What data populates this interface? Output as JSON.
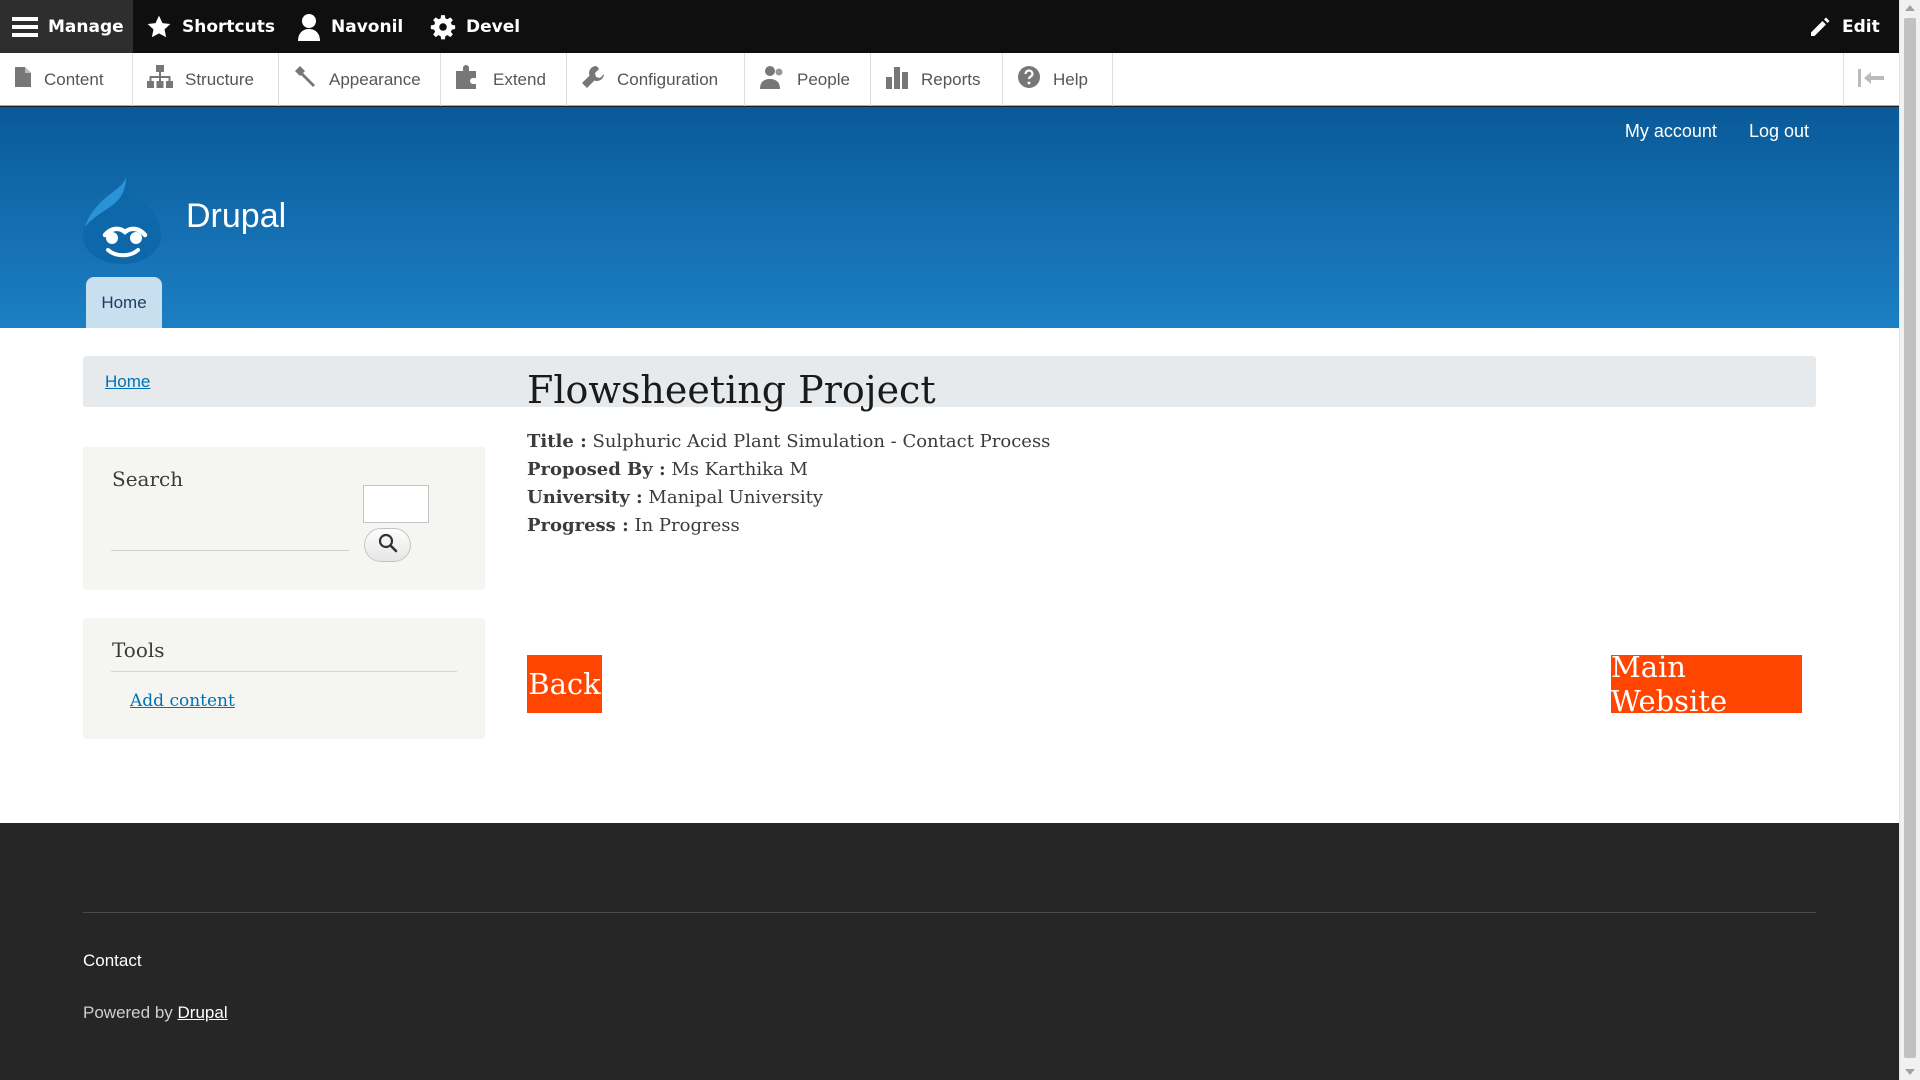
{
  "toolbar": {
    "manage": "Manage",
    "shortcuts": "Shortcuts",
    "user": "Navonil",
    "devel": "Devel",
    "edit": "Edit"
  },
  "tray": {
    "items": [
      "Content",
      "Structure",
      "Appearance",
      "Extend",
      "Configuration",
      "People",
      "Reports",
      "Help"
    ]
  },
  "header": {
    "my_account": "My account",
    "log_out": "Log out",
    "site_name": "Drupal",
    "home_tab": "Home"
  },
  "breadcrumb": {
    "home": "Home"
  },
  "sidebar": {
    "search_title": "Search",
    "tools_title": "Tools",
    "add_content": "Add content"
  },
  "content": {
    "title": "Flowsheeting Project",
    "fields": [
      {
        "label": "Title :",
        "value": "Sulphuric Acid Plant Simulation - Contact Process"
      },
      {
        "label": "Proposed By :",
        "value": "Ms Karthika M"
      },
      {
        "label": "University :",
        "value": "Manipal University"
      },
      {
        "label": "Progress :",
        "value": "In Progress"
      }
    ],
    "back_button": "Back",
    "main_website_button": "Main Website"
  },
  "footer": {
    "contact": "Contact",
    "powered_by": "Powered by",
    "drupal_link": "Drupal"
  },
  "colors": {
    "toolbar_bg": "#0f0f0f",
    "header_top": "#0a5a98",
    "header_bottom": "#1c7fc4",
    "accent_button": "#ff4500",
    "link": "#0071b3",
    "footer_bg": "#262626"
  }
}
